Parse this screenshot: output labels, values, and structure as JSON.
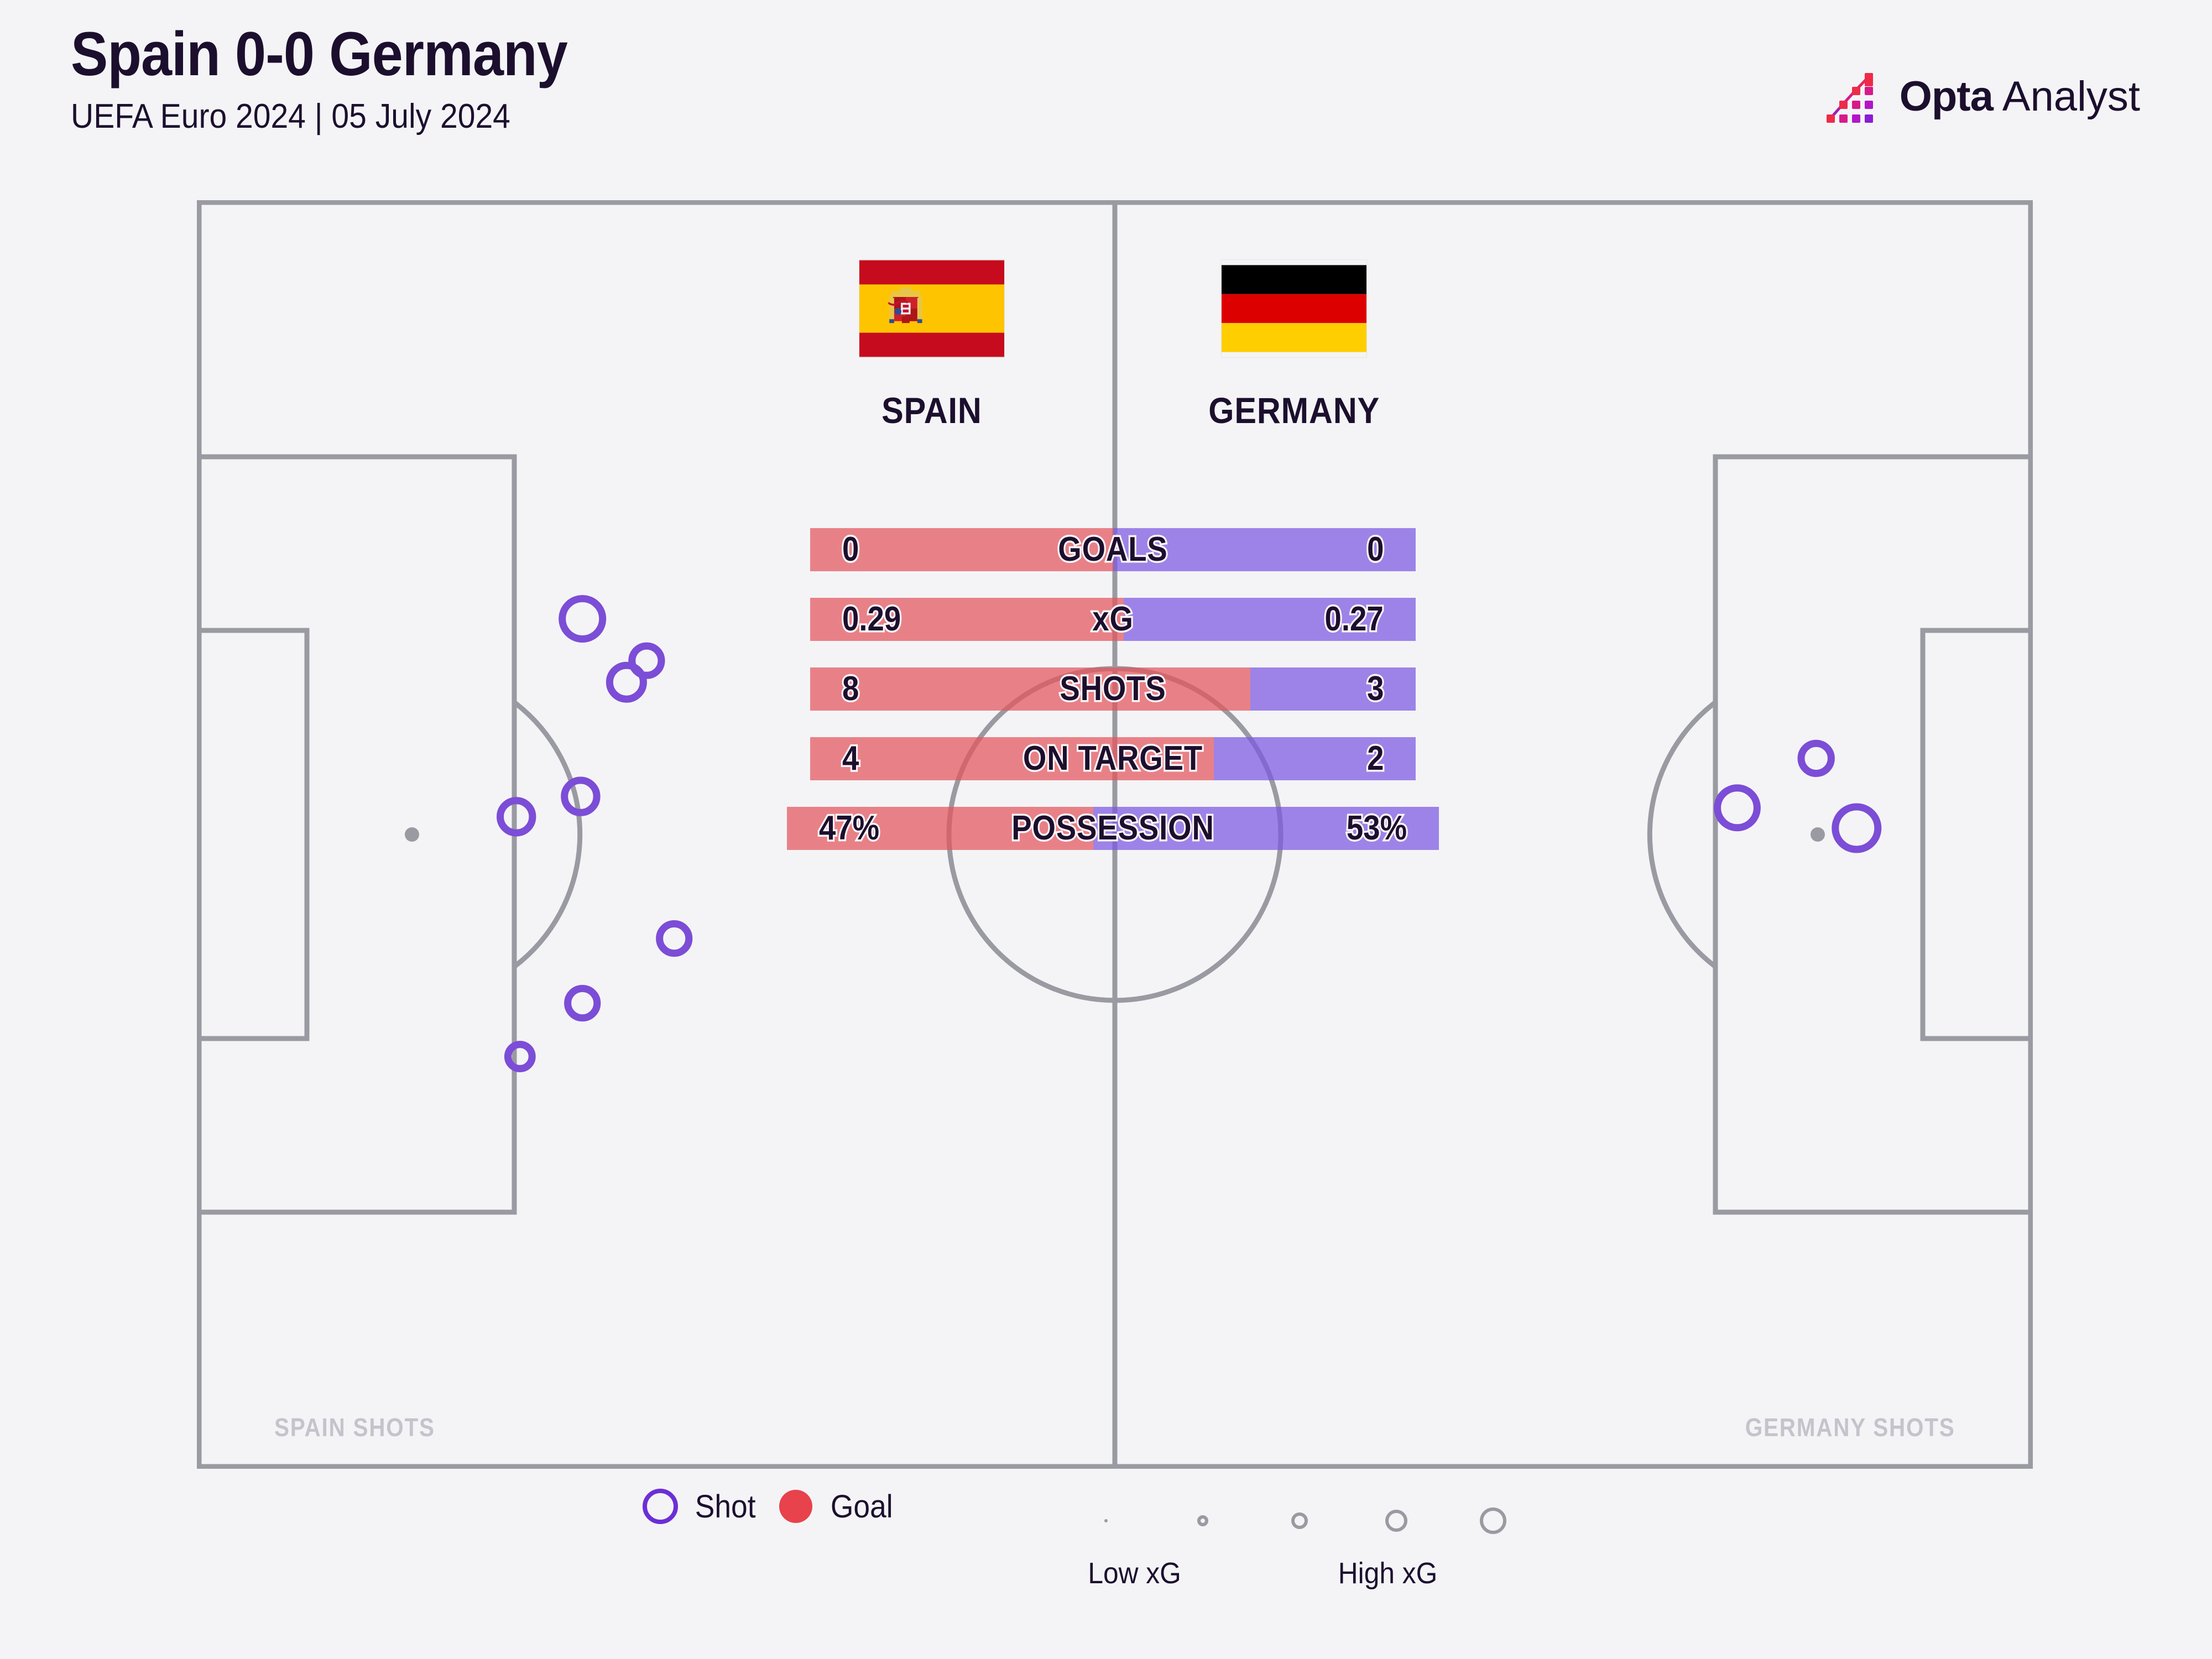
{
  "header": {
    "title": "Spain 0-0 Germany",
    "subtitle": "UEFA Euro 2024 | 05 July 2024",
    "brand_bold": "Opta",
    "brand_light": " Analyst"
  },
  "colors": {
    "home": "#E3545C",
    "away": "#7C58E2",
    "shot_marker": "#7C4DD6",
    "goal_marker": "#E8424C",
    "pitch_line": "#9a9aa2",
    "background": "#f4f4f6",
    "ink": "#1c0f2e"
  },
  "teams": {
    "home": {
      "name": "SPAIN",
      "flag": "spain-flag"
    },
    "away": {
      "name": "GERMANY",
      "flag": "germany-flag"
    }
  },
  "pitch": {
    "left_label": "SPAIN SHOTS",
    "right_label": "GERMANY SHOTS"
  },
  "chart_data": {
    "type": "bar",
    "title": "Spain 0-0 Germany",
    "subtitle": "UEFA Euro 2024 | 05 July 2024",
    "orientation": "horizontal-diverging",
    "series": [
      {
        "name": "SPAIN",
        "color": "#E3545C"
      },
      {
        "name": "GERMANY",
        "color": "#7C58E2"
      }
    ],
    "categories": [
      "GOALS",
      "xG",
      "SHOTS",
      "ON TARGET",
      "POSSESSION"
    ],
    "rows": [
      {
        "label": "GOALS",
        "home": "0",
        "away": "0",
        "home_pct": 50,
        "away_pct": 50,
        "wide": false
      },
      {
        "label": "xG",
        "home": "0.29",
        "away": "0.27",
        "home_pct": 51.8,
        "away_pct": 48.2,
        "wide": false
      },
      {
        "label": "SHOTS",
        "home": "8",
        "away": "3",
        "home_pct": 72.7,
        "away_pct": 27.3,
        "wide": false
      },
      {
        "label": "ON TARGET",
        "home": "4",
        "away": "2",
        "home_pct": 66.7,
        "away_pct": 33.3,
        "wide": false
      },
      {
        "label": "POSSESSION",
        "home": "47%",
        "away": "53%",
        "home_pct": 47,
        "away_pct": 53,
        "wide": true
      }
    ],
    "shot_map": {
      "units": "percent-of-pitch",
      "home_shots": [
        {
          "x": 21.0,
          "y": 33.0,
          "r": 1.1,
          "xg": 0.075
        },
        {
          "x": 24.5,
          "y": 36.3,
          "r": 0.8,
          "xg": 0.038
        },
        {
          "x": 23.4,
          "y": 38.0,
          "r": 0.92,
          "xg": 0.05
        },
        {
          "x": 20.9,
          "y": 47.0,
          "r": 0.88,
          "xg": 0.046
        },
        {
          "x": 17.4,
          "y": 48.6,
          "r": 0.88,
          "xg": 0.046
        },
        {
          "x": 26.0,
          "y": 58.2,
          "r": 0.8,
          "xg": 0.038
        },
        {
          "x": 21.0,
          "y": 63.3,
          "r": 0.8,
          "xg": 0.038
        },
        {
          "x": 17.6,
          "y": 67.5,
          "r": 0.66,
          "xg": 0.022
        }
      ],
      "away_shots": [
        {
          "x": 88.2,
          "y": 44.0,
          "r": 0.82,
          "xg": 0.055
        },
        {
          "x": 83.9,
          "y": 47.9,
          "r": 1.08,
          "xg": 0.11
        },
        {
          "x": 90.4,
          "y": 49.5,
          "r": 1.16,
          "xg": 0.125
        }
      ]
    }
  },
  "legend": {
    "shot_label": "Shot",
    "goal_label": "Goal",
    "low_xg": "Low xG",
    "high_xg": "High xG",
    "sizes": [
      6,
      20,
      30,
      40,
      48
    ]
  }
}
